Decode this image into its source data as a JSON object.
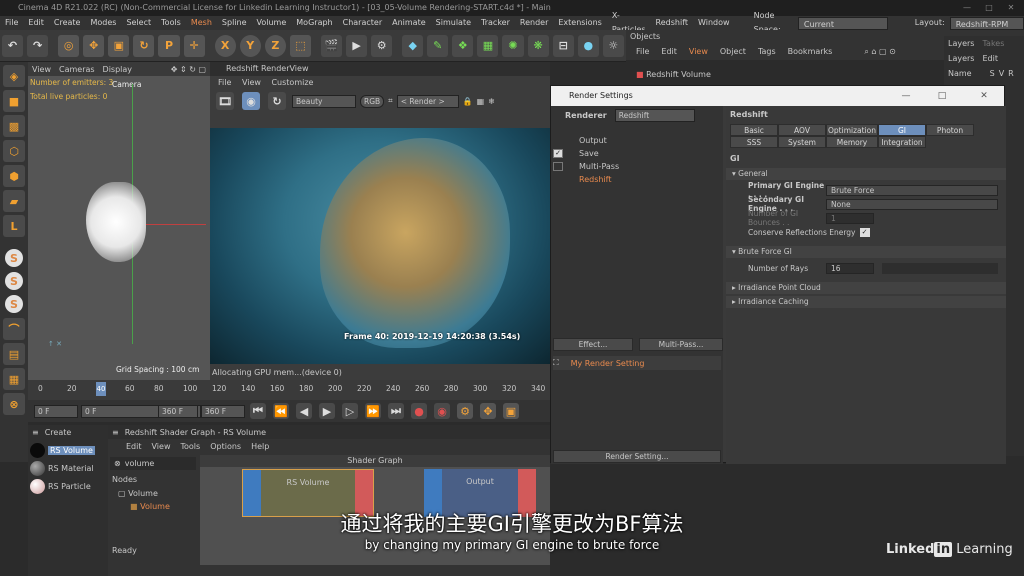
{
  "window": {
    "title": "Cinema 4D R21.022 (RC) (Non-Commercial License for Linkedin Learning Instructor1) - [03_05-Volume Rendering-START.c4d *] - Main"
  },
  "menubar": {
    "items": [
      "File",
      "Edit",
      "Create",
      "Modes",
      "Select",
      "Tools",
      "Mesh",
      "Spline",
      "Volume",
      "MoGraph",
      "Character",
      "Animate",
      "Simulate",
      "Tracker",
      "Render",
      "Extensions",
      "X-Particles",
      "Redshift",
      "Window"
    ],
    "node_space_label": "Node Space:",
    "node_space_value": "Current (Standard/Physical)",
    "layout_label": "Layout:",
    "layout_value": "Redshift-RPM (User)"
  },
  "toolbar": {
    "axis": [
      "X",
      "Y",
      "Z"
    ]
  },
  "viewport": {
    "menu": [
      "View",
      "Cameras",
      "Display"
    ],
    "camera_label": "Camera",
    "hud_emitters": "Number of emitters: 3",
    "hud_particles": "Total live particles: 0",
    "grid_spacing": "Grid Spacing : 100 cm"
  },
  "renderview": {
    "title": "Redshift RenderView",
    "menu": [
      "File",
      "View",
      "Customize"
    ],
    "aov": "Beauty",
    "rgb": "RGB",
    "render_target": "< Render >",
    "frame_info": "Frame  40:  2019-12-19  14:20:38  (3.54s)",
    "status": "Allocating GPU mem...(device 0)"
  },
  "objects_panel": {
    "tab": "Objects",
    "menu": [
      "File",
      "Edit",
      "View",
      "Object",
      "Tags",
      "Bookmarks"
    ],
    "item": "Redshift Volume"
  },
  "layers_panel": {
    "tabs": [
      "Layers",
      "Takes"
    ],
    "menu": [
      "Layers",
      "Edit"
    ],
    "col_name": "Name",
    "cols": [
      "S",
      "V",
      "R"
    ]
  },
  "render_settings": {
    "title": "Render Settings",
    "renderer_label": "Renderer",
    "renderer_value": "Redshift",
    "tree": [
      {
        "label": "Output",
        "checked": null,
        "active": false
      },
      {
        "label": "Save",
        "checked": true,
        "active": false
      },
      {
        "label": "Multi-Pass",
        "checked": false,
        "active": false
      },
      {
        "label": "Redshift",
        "checked": null,
        "active": true
      }
    ],
    "effect_button": "Effect...",
    "multipass_button": "Multi-Pass...",
    "setting_name": "My Render Setting",
    "render_setting_button": "Render Setting...",
    "panel_title": "Redshift",
    "tabs_row1": [
      {
        "label": "Basic",
        "active": false
      },
      {
        "label": "AOV",
        "active": false
      },
      {
        "label": "Optimization",
        "active": false
      },
      {
        "label": "GI",
        "active": true
      },
      {
        "label": "Photon",
        "active": false
      }
    ],
    "tabs_row2": [
      "SSS",
      "System",
      "Memory",
      "Integration"
    ],
    "gi_header": "GI",
    "general_header": "General",
    "primary_label": "Primary GI Engine . . . .",
    "primary_value": "Brute Force",
    "secondary_label": "Secondary GI Engine . . .",
    "secondary_value": "None",
    "bounces_label": "Number of GI Bounces . .",
    "bounces_value": "1",
    "conserve_label": "Conserve Reflections Energy",
    "conserve_checked": true,
    "bf_header": "Brute Force GI",
    "rays_label": "Number of Rays",
    "rays_value": "16",
    "irradiance_point_cloud": "Irradiance Point Cloud",
    "irradiance_caching": "Irradiance Caching"
  },
  "timeline": {
    "ticks": [
      "0",
      "20",
      "40",
      "60",
      "80",
      "100",
      "120",
      "140",
      "160",
      "180",
      "200",
      "220",
      "240",
      "260",
      "280",
      "300",
      "320",
      "340"
    ],
    "current_frame": "40",
    "start": "0 F",
    "start2": "0 F",
    "end": "360 F",
    "end2": "360 F"
  },
  "material_panel": {
    "menu": "Create",
    "materials": [
      "RS Volume",
      "RS Material",
      "RS Particle"
    ]
  },
  "shader_graph": {
    "title": "Redshift Shader Graph - RS Volume",
    "menu": [
      "Edit",
      "View",
      "Tools",
      "Options",
      "Help"
    ],
    "search": "volume",
    "nodes_label": "Nodes",
    "tree": [
      "Volume",
      "Volume"
    ],
    "graph_title": "Shader Graph",
    "node_a": "RS Volume",
    "node_b": "Output"
  },
  "status": "Ready",
  "subtitles": {
    "cn": "通过将我的主要GI引擎更改为BF算法",
    "en": "by changing my primary GI engine to brute force"
  },
  "brand": {
    "a": "Linked",
    "b": "in",
    "c": " Learning"
  }
}
